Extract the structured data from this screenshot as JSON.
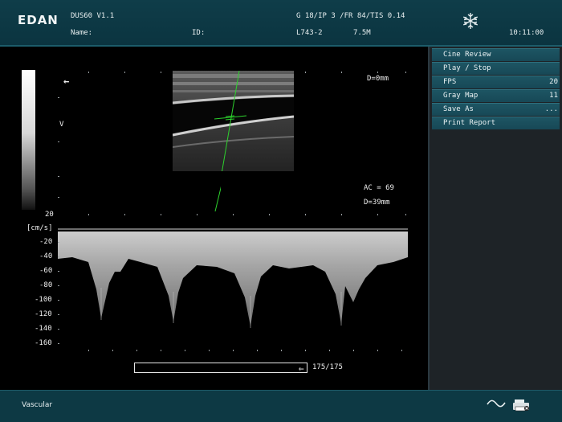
{
  "header": {
    "logo": "EDAN",
    "model": "DUS60 V1.1",
    "name_label": "Name:",
    "id_label": "ID:",
    "params": "G 18/IP 3 /FR 84/TIS 0.14",
    "probe": "L743-2",
    "frequency": "7.5M",
    "time": "10:11:00",
    "freeze_icon": "snowflake-icon"
  },
  "menu": {
    "items": [
      {
        "label": "Cine Review",
        "value": ""
      },
      {
        "label": "Play / Stop",
        "value": ""
      },
      {
        "label": "FPS",
        "value": "20"
      },
      {
        "label": "Gray Map",
        "value": "11"
      },
      {
        "label": "Save As",
        "value": "..."
      },
      {
        "label": "Print Report",
        "value": ""
      }
    ]
  },
  "image": {
    "depth_top": "D=0mm",
    "angle_correction": "AC = 69",
    "gate_depth": "D=39mm",
    "orientation_marker": "←",
    "scale_v": "V"
  },
  "doppler": {
    "unit": "[cm/s]",
    "scale_labels": [
      "20",
      "-20",
      "-40",
      "-60",
      "-80",
      "-100",
      "-120",
      "-140",
      "-160"
    ],
    "frame_counter": "175/175",
    "scroll_arrow": "⇐"
  },
  "footer": {
    "application": "Vascular",
    "icons": [
      "waveform-icon",
      "printer-icon"
    ]
  }
}
